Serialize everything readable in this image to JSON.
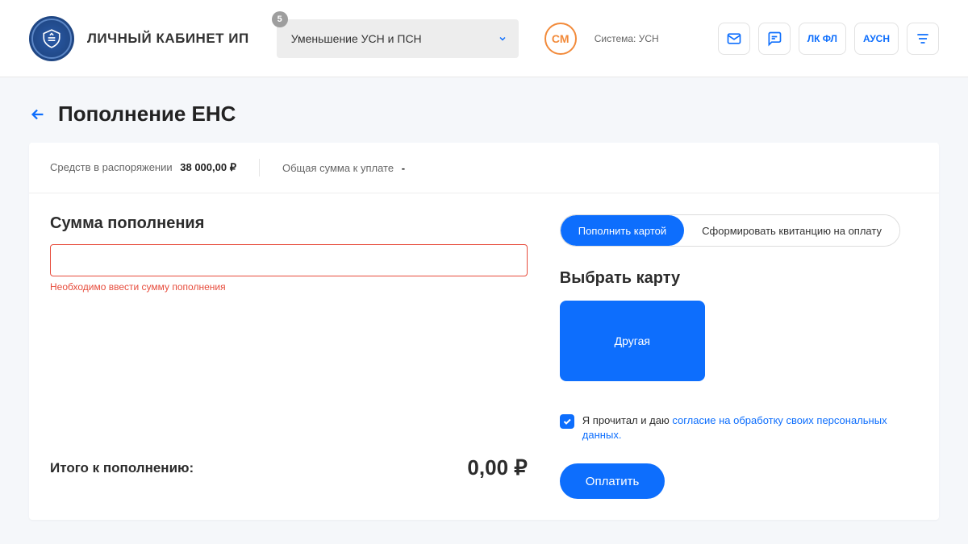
{
  "header": {
    "site_title": "ЛИЧНЫЙ КАБИНЕТ ИП",
    "dropdown_label": "Уменьшение УСН и ПСН",
    "dropdown_badge": "5",
    "avatar_initials": "СМ",
    "system_label": "Система: УСН",
    "nav_lk_fl": "ЛК ФЛ",
    "nav_ausn": "АУСН"
  },
  "page": {
    "title": "Пополнение ЕНС",
    "summary_label1": "Средств в распоряжении",
    "summary_value1": "38 000,00 ₽",
    "summary_label2": "Общая сумма к уплате",
    "summary_value2": "-"
  },
  "left": {
    "heading": "Сумма пополнения",
    "input_value": "",
    "error_msg": "Необходимо ввести сумму пополнения",
    "total_label": "Итого к пополнению:",
    "total_value": "0,00 ₽"
  },
  "right": {
    "tab_card": "Пополнить картой",
    "tab_receipt": "Сформировать квитанцию на оплату",
    "select_card_heading": "Выбрать карту",
    "card_other": "Другая",
    "consent_prefix": "Я прочитал и даю ",
    "consent_link": "согласие на обработку своих персональных данных.",
    "pay_button": "Оплатить"
  }
}
